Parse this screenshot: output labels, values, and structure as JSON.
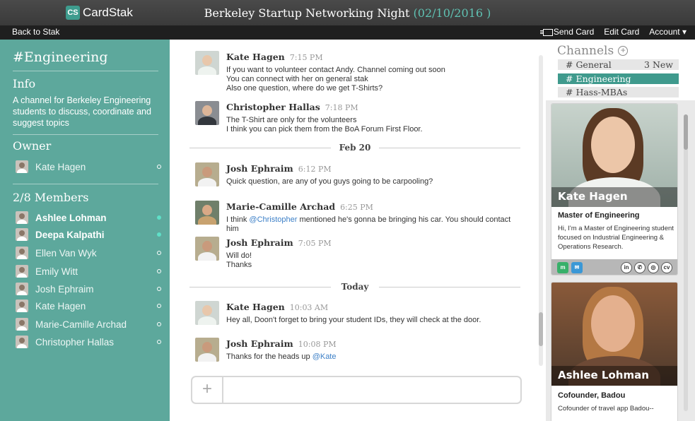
{
  "app": {
    "logo_mark": "CS",
    "logo_text": "CardStak"
  },
  "event": {
    "title": "Berkeley Startup Networking Night",
    "date": "(02/10/2016 )"
  },
  "subnav": {
    "back": "Back to Stak",
    "send_card": "Send Card",
    "edit_card": "Edit Card",
    "account": "Account ▾"
  },
  "sidebar": {
    "channel": "#Engineering",
    "info_title": "Info",
    "info_desc": "A channel for Berkeley Engineering students to discuss, coordinate and suggest topics",
    "owner_title": "Owner",
    "owner_name": "Kate Hagen",
    "members_title": "2/8 Members",
    "members": [
      {
        "name": "Ashlee Lohman",
        "online": true
      },
      {
        "name": "Deepa Kalpathi",
        "online": true
      },
      {
        "name": "Ellen Van Wyk",
        "online": false
      },
      {
        "name": "Emily Witt",
        "online": false
      },
      {
        "name": "Josh Ephraim",
        "online": false
      },
      {
        "name": "Kate Hagen",
        "online": false
      },
      {
        "name": "Marie-Camille Archad",
        "online": false
      },
      {
        "name": "Christopher Hallas",
        "online": false
      }
    ]
  },
  "chat": {
    "messages": [
      {
        "sender": "Kate Hagen",
        "time": "7:15 PM",
        "lines": [
          "If you want to volunteer contact Andy. Channel coming out soon",
          "You can connect with her on general stak",
          "Also one question, where do we get T-Shirts?"
        ]
      },
      {
        "sender": "Christopher Hallas",
        "time": "7:18 PM",
        "lines": [
          "The T-Shirt are only for the volunteers",
          "I think you can pick them from the BoA Forum First Floor."
        ]
      },
      {
        "sender": "Josh Ephraim",
        "time": "6:12 PM",
        "lines": [
          "Quick question, are any of you guys going to be carpooling?"
        ]
      },
      {
        "sender": "Marie-Camille Archad",
        "time": "6:25 PM",
        "line1_pre": "I think ",
        "line1_mention": "@Christopher",
        "line1_post": " mentioned he's gonna be bringing his car. You should contact",
        "line2": "him"
      },
      {
        "sender": "Josh Ephraim",
        "time": "7:05 PM",
        "lines": [
          "Will do!",
          "Thanks"
        ]
      },
      {
        "sender": "Kate Hagen",
        "time": "10:03 AM",
        "lines": [
          "Hey all, Doon't forget to bring your student IDs, they will check at the door."
        ]
      },
      {
        "sender": "Josh Ephraim",
        "time": "10:08 PM",
        "line1_pre": "Thanks for the heads up ",
        "line1_mention": "@Kate"
      }
    ],
    "separators": [
      "Feb 20",
      "Today"
    ],
    "composer_plus": "+",
    "composer_placeholder": ""
  },
  "right": {
    "channels_title": "Channels",
    "channels": [
      {
        "name": "# General",
        "badge": "3 New",
        "active": false
      },
      {
        "name": "# Engineering",
        "badge": "",
        "active": true
      },
      {
        "name": "# Hass-MBAs",
        "badge": "",
        "active": false
      }
    ],
    "cards": [
      {
        "name": "Kate Hagen",
        "title": "Master of Engineering",
        "desc": "Hi, I'm a Master of Engineering student focused on Industrial Engineering & Operations Research."
      },
      {
        "name": "Ashlee Lohman",
        "title": "Cofounder, Badou",
        "desc": "Cofounder of travel app Badou--"
      }
    ],
    "card_icons": [
      "meetup-icon",
      "chat-icon",
      "linkedin-icon",
      "phone-icon",
      "website-icon",
      "cv-icon"
    ],
    "card_icon_labels": {
      "meetup": "m",
      "chat": "✉",
      "linkedin": "in",
      "phone": "✆",
      "website": "◎",
      "cv": "cv"
    }
  },
  "colors": {
    "accent": "#5da89c",
    "active_channel": "#3f9a8d",
    "date": "#5fc1b2",
    "mention": "#3b7fc7"
  }
}
